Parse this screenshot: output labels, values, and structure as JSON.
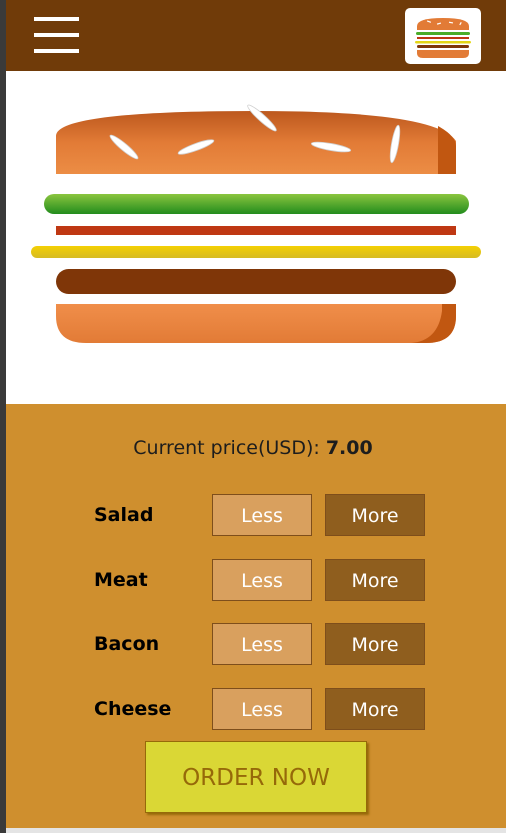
{
  "toolbar": {
    "menu_icon": "hamburger-menu-icon",
    "logo_icon": "burger-logo-icon"
  },
  "price": {
    "label": "Current price(USD):",
    "value": "7.00"
  },
  "controls": [
    {
      "label": "Salad",
      "less_label": "Less",
      "more_label": "More"
    },
    {
      "label": "Meat",
      "less_label": "Less",
      "more_label": "More"
    },
    {
      "label": "Bacon",
      "less_label": "Less",
      "more_label": "More"
    },
    {
      "label": "Cheese",
      "less_label": "Less",
      "more_label": "More"
    }
  ],
  "order_button": {
    "label": "ORDER NOW"
  },
  "colors": {
    "toolbar": "#703b09",
    "controls_background": "#cf8f2e",
    "less_button": "#d9a05e",
    "more_button": "#8f5e1e",
    "order_button": "#dad735",
    "bread": "#e27b36",
    "salad": "#4aad29",
    "bacon": "#bf3813",
    "cheese": "#e4d616",
    "meat": "#7f3608"
  }
}
